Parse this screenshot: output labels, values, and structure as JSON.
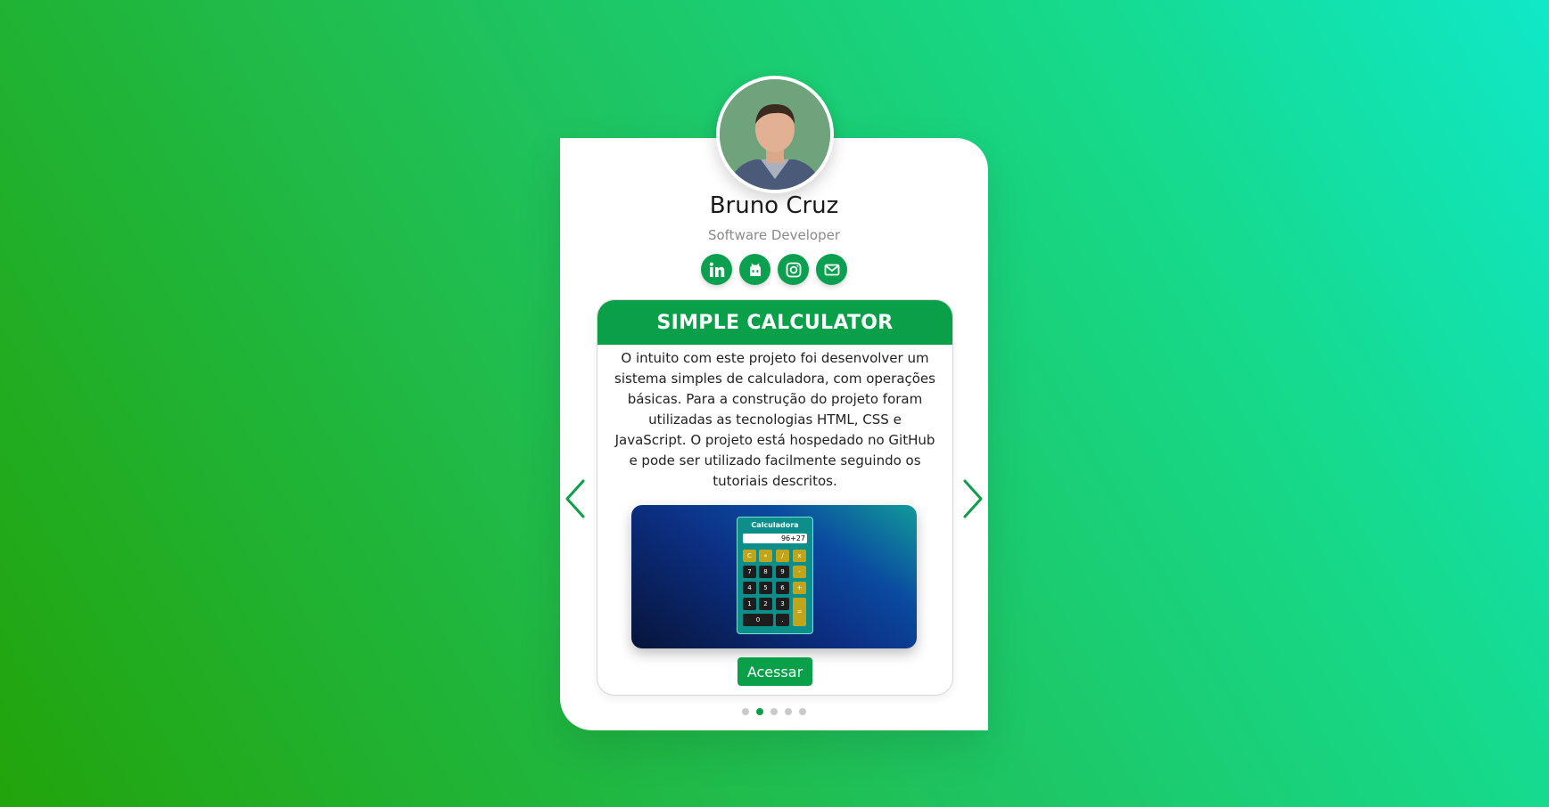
{
  "profile": {
    "name": "Bruno Cruz",
    "role": "Software Developer",
    "avatar": "profile-photo"
  },
  "socials": [
    {
      "icon": "linkedin-icon",
      "label": "in"
    },
    {
      "icon": "github-icon"
    },
    {
      "icon": "instagram-icon"
    },
    {
      "icon": "email-icon"
    }
  ],
  "project": {
    "title": "SIMPLE CALCULATOR",
    "description": "O intuito com este projeto foi desenvolver um sistema simples de calculadora, com operações básicas. Para a construção do projeto foram utilizadas as tecnologias HTML, CSS e JavaScript. O projeto está hospedado no GitHub e pode ser utilizado facilmente seguindo os tutoriais descritos.",
    "button_label": "Acessar",
    "screenshot": {
      "title": "Calculadora",
      "display": "96+27",
      "keys": [
        "C",
        "«",
        "/",
        "x",
        "7",
        "8",
        "9",
        "-",
        "4",
        "5",
        "6",
        "+",
        "1",
        "2",
        "3",
        "=",
        "0",
        "."
      ]
    }
  },
  "carousel": {
    "total": 5,
    "active_index": 1,
    "prev_icon": "chevron-left-icon",
    "next_icon": "chevron-right-icon"
  },
  "colors": {
    "accent": "#0aa04a",
    "background_start": "#22a40b",
    "background_end": "#10e8c8"
  }
}
